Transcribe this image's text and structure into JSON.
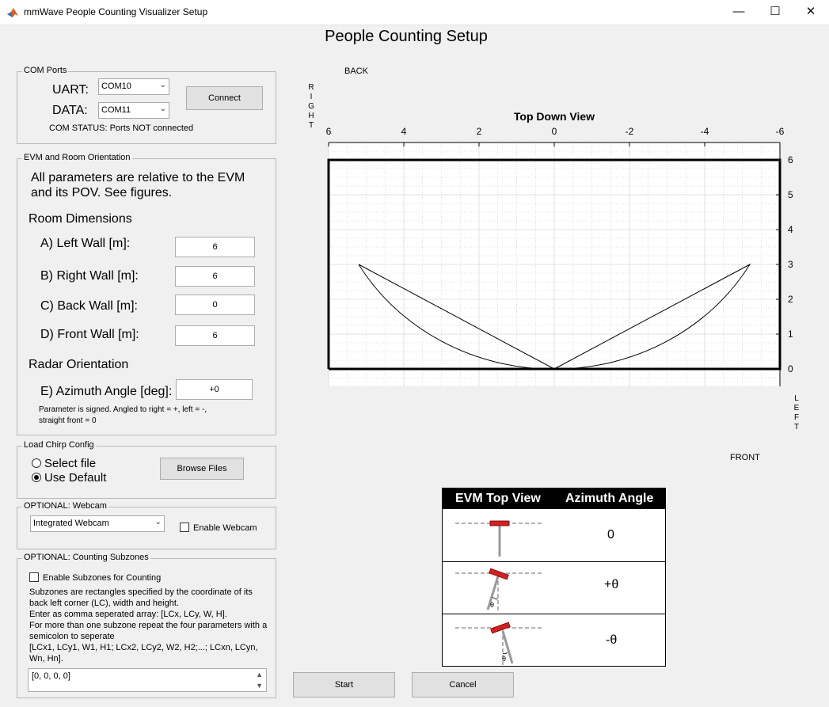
{
  "window": {
    "title": "mmWave People Counting Visualizer Setup",
    "minimize": "—",
    "maximize": "☐",
    "close": "✕"
  },
  "heading": "People Counting Setup",
  "com_ports": {
    "group_label": "COM Ports",
    "uart_label": "UART:",
    "uart_value": "COM10",
    "data_label": "DATA:",
    "data_value": "COM11",
    "connect_label": "Connect",
    "status_text": "COM STATUS: Ports NOT connected"
  },
  "evm": {
    "group_label": "EVM and Room Orientation",
    "intro_line1": "All parameters are relative to the EVM",
    "intro_line2": "and its POV.  See figures.",
    "room_dims_label": "Room Dimensions",
    "left_wall_label": "A) Left Wall [m]:",
    "left_wall_value": "6",
    "right_wall_label": "B) Right Wall [m]:",
    "right_wall_value": "6",
    "back_wall_label": "C) Back Wall [m]:",
    "back_wall_value": "0",
    "front_wall_label": "D) Front Wall [m]:",
    "front_wall_value": "6",
    "radar_orient_label": "Radar Orientation",
    "azimuth_label": "E) Azimuth Angle [deg]:",
    "azimuth_value": "+0",
    "note_line1": "Parameter is signed. Angled to right = +, left = -,",
    "note_line2": "straight front = 0"
  },
  "chirp": {
    "group_label": "Load Chirp Config",
    "select_file_label": "Select file",
    "use_default_label": "Use Default",
    "browse_label": "Browse Files",
    "selected": "Use Default"
  },
  "webcam": {
    "group_label": "OPTIONAL: Webcam",
    "device_value": "Integrated Webcam",
    "enable_label": "Enable Webcam"
  },
  "subzones": {
    "group_label": "OPTIONAL: Counting Subzones",
    "enable_label": "Enable Subzones for Counting",
    "desc1": "Subzones are rectangles specified by the coordinate of its",
    "desc2": "back left corner (LC), width and height.",
    "desc3": "Enter as comma seperated array: [LCx, LCy, W, H].",
    "desc4": "For more than one subzone repeat the four parameters with a",
    "desc5": "semicolon to seperate",
    "desc6": "[LCx1, LCy1, W1, H1; LCx2, LCy2, W2, H2;...; LCxn, LCyn,",
    "desc7": "Wn, Hn].",
    "value": "[0, 0, 0, 0]"
  },
  "plot_labels": {
    "back": "BACK",
    "front": "FRONT",
    "right": [
      "R",
      "I",
      "G",
      "H",
      "T"
    ],
    "left": [
      "L",
      "E",
      "F",
      "T"
    ]
  },
  "chart_data": {
    "type": "line",
    "title": "Top Down View",
    "xlim": [
      6,
      -6
    ],
    "ylim": [
      6.5,
      -0.5
    ],
    "xticks": [
      6,
      4,
      2,
      0,
      -2,
      -4,
      -6
    ],
    "xtick_labels": [
      "6",
      "4",
      "2",
      "0",
      "-2",
      "-4",
      "-6"
    ],
    "yticks": [
      0,
      1,
      2,
      3,
      4,
      5,
      6
    ],
    "ytick_labels": [
      "0",
      "1",
      "2",
      "3",
      "4",
      "5",
      "6"
    ],
    "x_axis_position": "top",
    "y_axis_position": "right",
    "grid": "minor dotted",
    "room_boundary": {
      "x": [
        6,
        -6,
        -6,
        6,
        6
      ],
      "y": [
        0,
        0,
        6,
        6,
        0
      ]
    },
    "sensor_coverage": {
      "apex": [
        0,
        0
      ],
      "left_edge_end": [
        5.2,
        3
      ],
      "right_edge_end": [
        -5.2,
        3
      ],
      "arc_radius": 6,
      "arc_bottom": [
        0,
        6
      ]
    }
  },
  "evm_table": {
    "col1_header": "EVM Top View",
    "col2_header": "Azimuth Angle",
    "rows": [
      {
        "angle": "0",
        "theta_mark": ""
      },
      {
        "angle": "+θ",
        "theta_mark": "θ"
      },
      {
        "angle": "-θ",
        "theta_mark": "θ"
      }
    ]
  },
  "footer": {
    "start_label": "Start",
    "cancel_label": "Cancel"
  },
  "colors": {
    "background": "#f0f0f0",
    "evm_red": "#d42020",
    "table_header": "#000000"
  }
}
